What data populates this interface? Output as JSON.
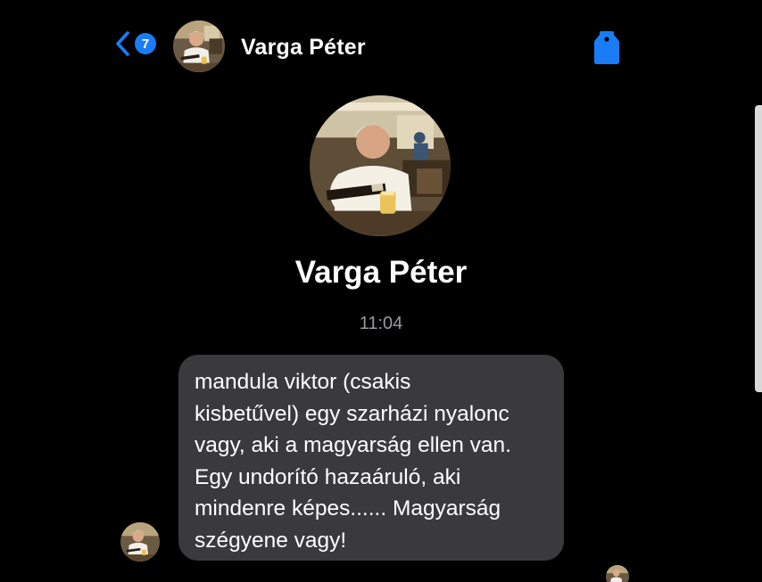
{
  "header": {
    "unread_count": "7",
    "contact_name": "Varga Péter",
    "back_icon": "chevron-left-icon",
    "tag_icon": "tag-icon"
  },
  "profile": {
    "name": "Varga Péter"
  },
  "conversation": {
    "timestamp": "11:04",
    "messages": [
      {
        "sender": "Varga Péter",
        "text": "mandula viktor (csakis\nkisbetűvel) egy szarházi nyalonc\nvagy, aki a magyarság ellen van.\nEgy undorító hazaáruló, aki\nmindenre képes...... Magyarság\nszégyene vagy!"
      }
    ]
  },
  "colors": {
    "background": "#000000",
    "accent": "#1a7cf6",
    "bubble": "#3a3a3c",
    "timestamp": "#9a9a9f"
  }
}
